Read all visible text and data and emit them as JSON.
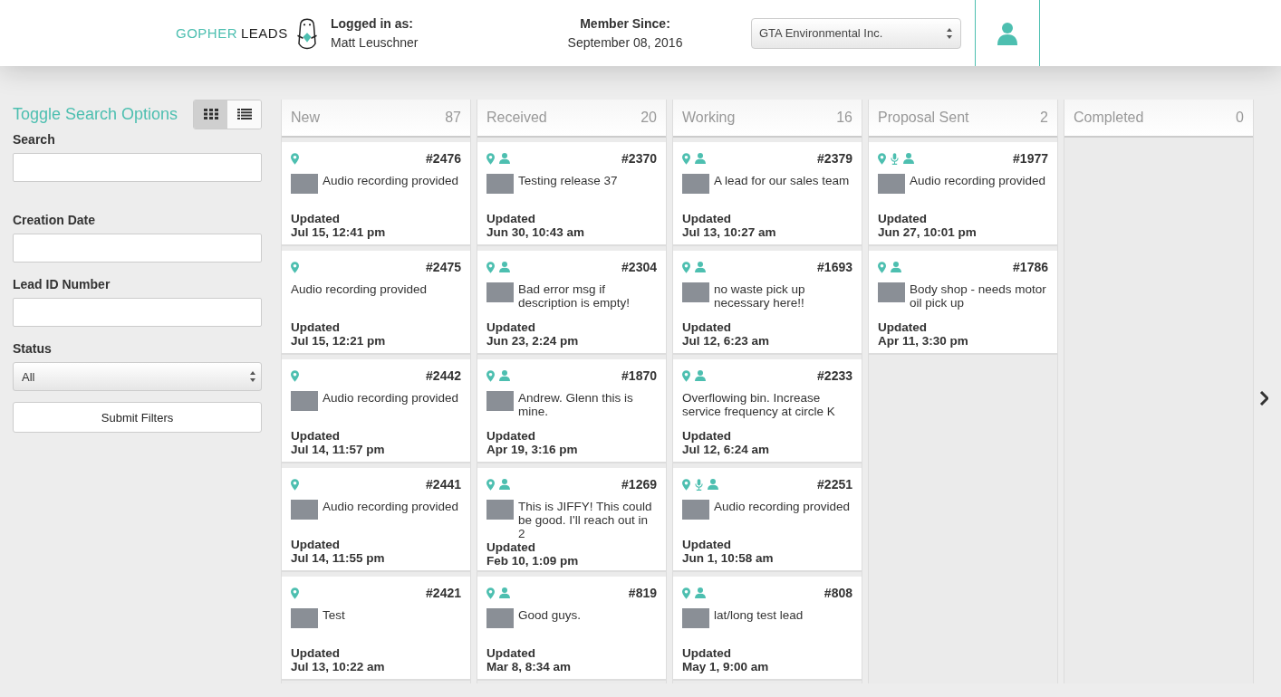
{
  "header": {
    "logo": [
      "GOPHER",
      "LEADS"
    ],
    "logged_in_label": "Logged in as:",
    "user_name": "Matt Leuschner",
    "member_label": "Member Since:",
    "member_date": "September 08, 2016",
    "company_select": "GTA Environmental Inc."
  },
  "sidebar": {
    "toggle_link": "Toggle Search Options",
    "views": [
      {
        "kind": "grid",
        "selected": true
      },
      {
        "kind": "list",
        "selected": false
      }
    ],
    "fields": [
      {
        "label": "Search",
        "kind": "text"
      },
      {
        "label": "Creation Date",
        "kind": "text"
      },
      {
        "label": "Lead ID Number",
        "kind": "text"
      },
      {
        "label": "Status",
        "kind": "select",
        "value": "All"
      }
    ],
    "submit": "Submit Filters"
  },
  "columns": [
    {
      "title": "New",
      "count": "87",
      "cards": [
        {
          "id": "#2476",
          "location": true,
          "audio": false,
          "person": false,
          "photo": true,
          "description": "Audio recording provided",
          "updated_label": "Updated",
          "updated": "Jul 15, 12:41 pm"
        },
        {
          "id": "#2475",
          "location": true,
          "audio": false,
          "person": false,
          "photo": false,
          "description": "Audio recording provided",
          "updated_label": "Updated",
          "updated": "Jul 15, 12:21 pm"
        },
        {
          "id": "#2442",
          "location": true,
          "audio": false,
          "person": false,
          "photo": true,
          "description": "Audio recording provided",
          "updated_label": "Updated",
          "updated": "Jul 14, 11:57 pm"
        },
        {
          "id": "#2441",
          "location": true,
          "audio": false,
          "person": false,
          "photo": true,
          "description": "Audio recording provided",
          "updated_label": "Updated",
          "updated": "Jul 14, 11:55 pm"
        },
        {
          "id": "#2421",
          "location": true,
          "audio": false,
          "person": false,
          "photo": true,
          "description": "Test",
          "updated_label": "Updated",
          "updated": "Jul 13, 10:22 am"
        }
      ]
    },
    {
      "title": "Received",
      "count": "20",
      "cards": [
        {
          "id": "#2370",
          "location": true,
          "audio": false,
          "person": true,
          "photo": true,
          "description": "Testing release 37",
          "updated_label": "Updated",
          "updated": "Jun 30, 10:43 am"
        },
        {
          "id": "#2304",
          "location": true,
          "audio": false,
          "person": true,
          "photo": true,
          "description": "Bad error msg if description is empty!",
          "updated_label": "Updated",
          "updated": "Jun 23, 2:24 pm"
        },
        {
          "id": "#1870",
          "location": true,
          "audio": false,
          "person": true,
          "photo": true,
          "description": "Andrew. Glenn this is mine.",
          "updated_label": "Updated",
          "updated": "Apr 19, 3:16 pm"
        },
        {
          "id": "#1269",
          "location": true,
          "audio": false,
          "person": true,
          "photo": true,
          "description": "This is JIFFY! This could be good. I'll reach out in 2",
          "updated_label": "Updated",
          "updated": "Feb 10, 1:09 pm"
        },
        {
          "id": "#819",
          "location": true,
          "audio": false,
          "person": true,
          "photo": true,
          "description": "Good guys.",
          "updated_label": "Updated",
          "updated": "Mar 8, 8:34 am"
        }
      ]
    },
    {
      "title": "Working",
      "count": "16",
      "cards": [
        {
          "id": "#2379",
          "location": true,
          "audio": false,
          "person": true,
          "photo": true,
          "description": "A lead for our sales team",
          "updated_label": "Updated",
          "updated": "Jul 13, 10:27 am"
        },
        {
          "id": "#1693",
          "location": true,
          "audio": false,
          "person": true,
          "photo": true,
          "description": "no waste pick up necessary here!!",
          "updated_label": "Updated",
          "updated": "Jul 12, 6:23 am"
        },
        {
          "id": "#2233",
          "location": true,
          "audio": false,
          "person": true,
          "photo": false,
          "description": "Overflowing bin. Increase service frequency at circle K",
          "updated_label": "Updated",
          "updated": "Jul 12, 6:24 am"
        },
        {
          "id": "#2251",
          "location": true,
          "audio": true,
          "person": true,
          "photo": true,
          "description": "Audio recording provided",
          "updated_label": "Updated",
          "updated": "Jun 1, 10:58 am"
        },
        {
          "id": "#808",
          "location": true,
          "audio": false,
          "person": true,
          "photo": true,
          "description": "lat/long test lead",
          "updated_label": "Updated",
          "updated": "May 1, 9:00 am"
        }
      ]
    },
    {
      "title": "Proposal Sent",
      "count": "2",
      "cards": [
        {
          "id": "#1977",
          "location": true,
          "audio": true,
          "person": true,
          "photo": true,
          "description": "Audio recording provided",
          "updated_label": "Updated",
          "updated": "Jun 27, 10:01 pm"
        },
        {
          "id": "#1786",
          "location": true,
          "audio": false,
          "person": true,
          "photo": true,
          "description": "Body shop - needs motor oil pick up",
          "updated_label": "Updated",
          "updated": "Apr 11, 3:30 pm"
        }
      ]
    },
    {
      "title": "Completed",
      "count": "0"
    }
  ]
}
